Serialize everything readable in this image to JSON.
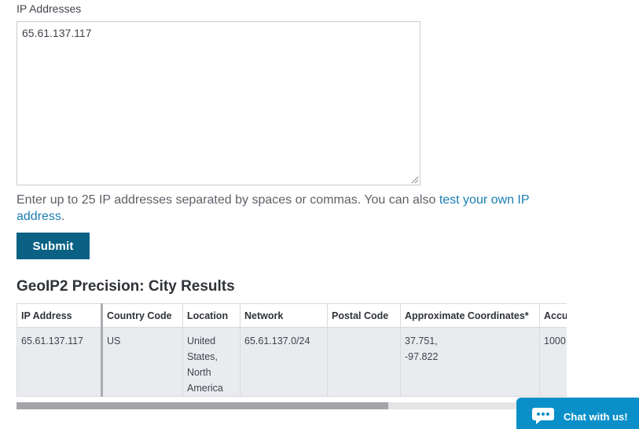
{
  "form": {
    "label": "IP Addresses",
    "textarea_value": "65.61.137.117",
    "help_text": "Enter up to 25 IP addresses separated by spaces or commas. You can also ",
    "help_link": "test your own IP address",
    "help_end": ".",
    "submit_label": "Submit"
  },
  "results": {
    "title": "GeoIP2 Precision: City Results",
    "columns": [
      "IP Address",
      "Country Code",
      "Location",
      "Network",
      "Postal Code",
      "Approximate Coordinates*",
      "Accuracy Radius"
    ],
    "rows": [
      {
        "ip": "65.61.137.117",
        "country_code": "US",
        "location_lines": [
          "United",
          "States,",
          "North",
          "America"
        ],
        "network": "65.61.137.0/24",
        "postal_code": "",
        "coord_lines": [
          "37.751,",
          "-97.822"
        ],
        "accuracy_radius": "1000"
      }
    ]
  },
  "chat": {
    "label": "Chat with us!",
    "icon": "chat-bubble-icon"
  },
  "colors": {
    "button": "#0a6184",
    "link": "#1a7db3",
    "chat": "#0b8fc9"
  }
}
